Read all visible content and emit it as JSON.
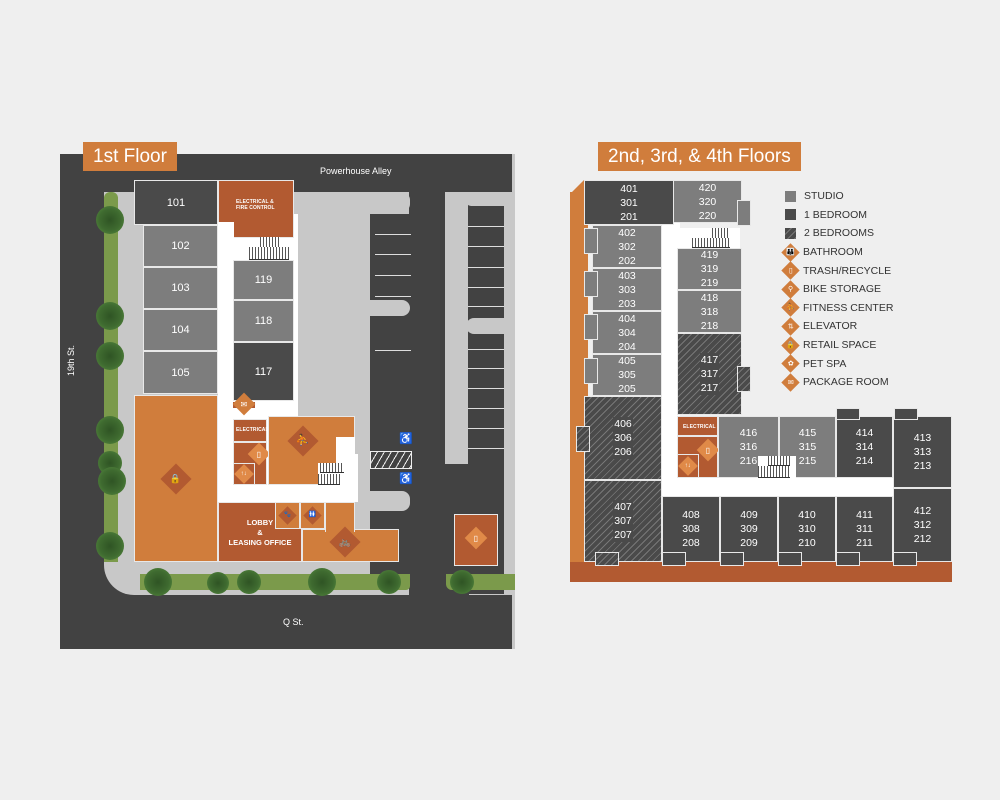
{
  "first_floor": {
    "title": "1st Floor",
    "streets": {
      "north": "Powerhouse Alley",
      "west": "19th St.",
      "south": "Q St."
    },
    "units": {
      "u101": "101",
      "u102": "102",
      "u103": "103",
      "u104": "104",
      "u105": "105",
      "u117": "117",
      "u118": "118",
      "u119": "119"
    },
    "rooms": {
      "electrical_fire": "ELECTRICAL & FIRE CONTROL",
      "electrical": "ELECTRICAL",
      "lobby": "LOBBY & LEASING OFFICE",
      "lobby_line1": "LOBBY",
      "lobby_line2": "&",
      "lobby_line3": "LEASING OFFICE"
    },
    "icons": {
      "retail": "🔒",
      "package": "✉",
      "trash": "▯",
      "elevator": "↑↓",
      "fitness": "⛹",
      "pet": "🐾",
      "bathroom": "🚻",
      "bike": "🚲",
      "handicap": "♿"
    }
  },
  "upper_floors": {
    "title": "2nd, 3rd, & 4th Floors",
    "units": [
      {
        "id": "s01",
        "numbers": [
          "401",
          "301",
          "201"
        ],
        "type": "1 BEDROOM"
      },
      {
        "id": "s02",
        "numbers": [
          "402",
          "302",
          "202"
        ],
        "type": "STUDIO"
      },
      {
        "id": "s03",
        "numbers": [
          "403",
          "303",
          "203"
        ],
        "type": "STUDIO"
      },
      {
        "id": "s04",
        "numbers": [
          "404",
          "304",
          "204"
        ],
        "type": "STUDIO"
      },
      {
        "id": "s05",
        "numbers": [
          "405",
          "305",
          "205"
        ],
        "type": "STUDIO"
      },
      {
        "id": "s06",
        "numbers": [
          "406",
          "306",
          "206"
        ],
        "type": "2 BEDROOMS"
      },
      {
        "id": "s07",
        "numbers": [
          "407",
          "307",
          "207"
        ],
        "type": "2 BEDROOMS"
      },
      {
        "id": "s08",
        "numbers": [
          "408",
          "308",
          "208"
        ],
        "type": "1 BEDROOM"
      },
      {
        "id": "s09",
        "numbers": [
          "409",
          "309",
          "209"
        ],
        "type": "1 BEDROOM"
      },
      {
        "id": "s10",
        "numbers": [
          "410",
          "310",
          "210"
        ],
        "type": "1 BEDROOM"
      },
      {
        "id": "s11",
        "numbers": [
          "411",
          "311",
          "211"
        ],
        "type": "1 BEDROOM"
      },
      {
        "id": "s12",
        "numbers": [
          "412",
          "312",
          "212"
        ],
        "type": "1 BEDROOM"
      },
      {
        "id": "s13",
        "numbers": [
          "413",
          "313",
          "213"
        ],
        "type": "1 BEDROOM"
      },
      {
        "id": "s14",
        "numbers": [
          "414",
          "314",
          "214"
        ],
        "type": "1 BEDROOM"
      },
      {
        "id": "s15",
        "numbers": [
          "415",
          "315",
          "215"
        ],
        "type": "STUDIO"
      },
      {
        "id": "s16",
        "numbers": [
          "416",
          "316",
          "216"
        ],
        "type": "STUDIO"
      },
      {
        "id": "s17",
        "numbers": [
          "417",
          "317",
          "217"
        ],
        "type": "2 BEDROOMS"
      },
      {
        "id": "s18",
        "numbers": [
          "418",
          "318",
          "218"
        ],
        "type": "STUDIO"
      },
      {
        "id": "s19",
        "numbers": [
          "419",
          "319",
          "219"
        ],
        "type": "STUDIO"
      },
      {
        "id": "s20",
        "numbers": [
          "420",
          "320",
          "220"
        ],
        "type": "STUDIO"
      }
    ],
    "rooms": {
      "electrical": "ELECTRICAL"
    }
  },
  "legend": {
    "items": [
      {
        "label": "STUDIO",
        "kind": "swatch",
        "color": "#7d7d7d"
      },
      {
        "label": "1 BEDROOM",
        "kind": "swatch",
        "color": "#4a4a4a"
      },
      {
        "label": "2 BEDROOMS",
        "kind": "hatch",
        "color": "#4a4a4a"
      },
      {
        "label": "BATHROOM",
        "kind": "icon",
        "glyph": "👪"
      },
      {
        "label": "TRASH/RECYCLE",
        "kind": "icon",
        "glyph": "▯"
      },
      {
        "label": "BIKE STORAGE",
        "kind": "icon",
        "glyph": "⚲"
      },
      {
        "label": "FITNESS CENTER",
        "kind": "icon",
        "glyph": "⛹"
      },
      {
        "label": "ELEVATOR",
        "kind": "icon",
        "glyph": "⇅"
      },
      {
        "label": "RETAIL SPACE",
        "kind": "icon",
        "glyph": "🔒"
      },
      {
        "label": "PET SPA",
        "kind": "icon",
        "glyph": "✿"
      },
      {
        "label": "PACKAGE ROOM",
        "kind": "icon",
        "glyph": "✉"
      }
    ]
  },
  "colors": {
    "accent_orange": "#d07d3c",
    "rust": "#b25a31",
    "studio_gray": "#7d7d7d",
    "one_bedroom_gray": "#4a4a4a",
    "road": "#424242",
    "sidewalk": "#c8c8c8",
    "grass": "#7b9a4b"
  }
}
